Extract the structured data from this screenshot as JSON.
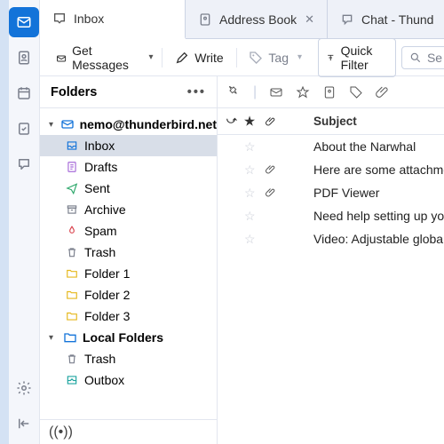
{
  "rail": {
    "items": [
      {
        "name": "mail-icon",
        "active": true
      },
      {
        "name": "address-book-icon",
        "active": false
      },
      {
        "name": "calendar-icon",
        "active": false
      },
      {
        "name": "tasks-icon",
        "active": false
      },
      {
        "name": "chat-icon",
        "active": false
      }
    ],
    "bottom": [
      {
        "name": "settings-icon"
      },
      {
        "name": "collapse-icon"
      }
    ]
  },
  "tabs": [
    {
      "label": "Inbox",
      "icon": "inbox-icon",
      "active": true,
      "closable": false
    },
    {
      "label": "Address Book",
      "icon": "address-book-icon",
      "active": false,
      "closable": true
    },
    {
      "label": "Chat - Thund",
      "icon": "chat-icon",
      "active": false,
      "closable": false
    }
  ],
  "toolbar": {
    "get_messages": "Get Messages",
    "write": "Write",
    "tag": "Tag",
    "quick_filter": "Quick Filter",
    "search_placeholder": "Se"
  },
  "folders": {
    "header": "Folders",
    "accounts": [
      {
        "label": "nemo@thunderbird.net",
        "expanded": true,
        "folders": [
          {
            "label": "Inbox",
            "icon": "inbox",
            "selected": true
          },
          {
            "label": "Drafts",
            "icon": "drafts",
            "selected": false
          },
          {
            "label": "Sent",
            "icon": "sent",
            "selected": false
          },
          {
            "label": "Archive",
            "icon": "archive",
            "selected": false
          },
          {
            "label": "Spam",
            "icon": "spam",
            "selected": false
          },
          {
            "label": "Trash",
            "icon": "trash",
            "selected": false
          },
          {
            "label": "Folder 1",
            "icon": "folder",
            "selected": false
          },
          {
            "label": "Folder 2",
            "icon": "folder",
            "selected": false
          },
          {
            "label": "Folder 3",
            "icon": "folder",
            "selected": false
          }
        ]
      },
      {
        "label": "Local Folders",
        "expanded": true,
        "folders": [
          {
            "label": "Trash",
            "icon": "trash",
            "selected": false
          },
          {
            "label": "Outbox",
            "icon": "outbox",
            "selected": false
          }
        ]
      }
    ]
  },
  "messages": {
    "col_subject": "Subject",
    "rows": [
      {
        "subject": "About the Narwhal",
        "attachment": false
      },
      {
        "subject": "Here are some attachme",
        "attachment": true
      },
      {
        "subject": "PDF Viewer",
        "attachment": true
      },
      {
        "subject": "Need help setting up yo",
        "attachment": false
      },
      {
        "subject": "Video: Adjustable global",
        "attachment": false
      }
    ]
  },
  "colors": {
    "accent": "#1373d9",
    "teal": "#1fa5a0",
    "purple": "#a76cd9",
    "green": "#2ea86b",
    "orange": "#e68a1d",
    "red": "#d9434e",
    "gray": "#7a7f8c",
    "yellow": "#e6b81d"
  }
}
